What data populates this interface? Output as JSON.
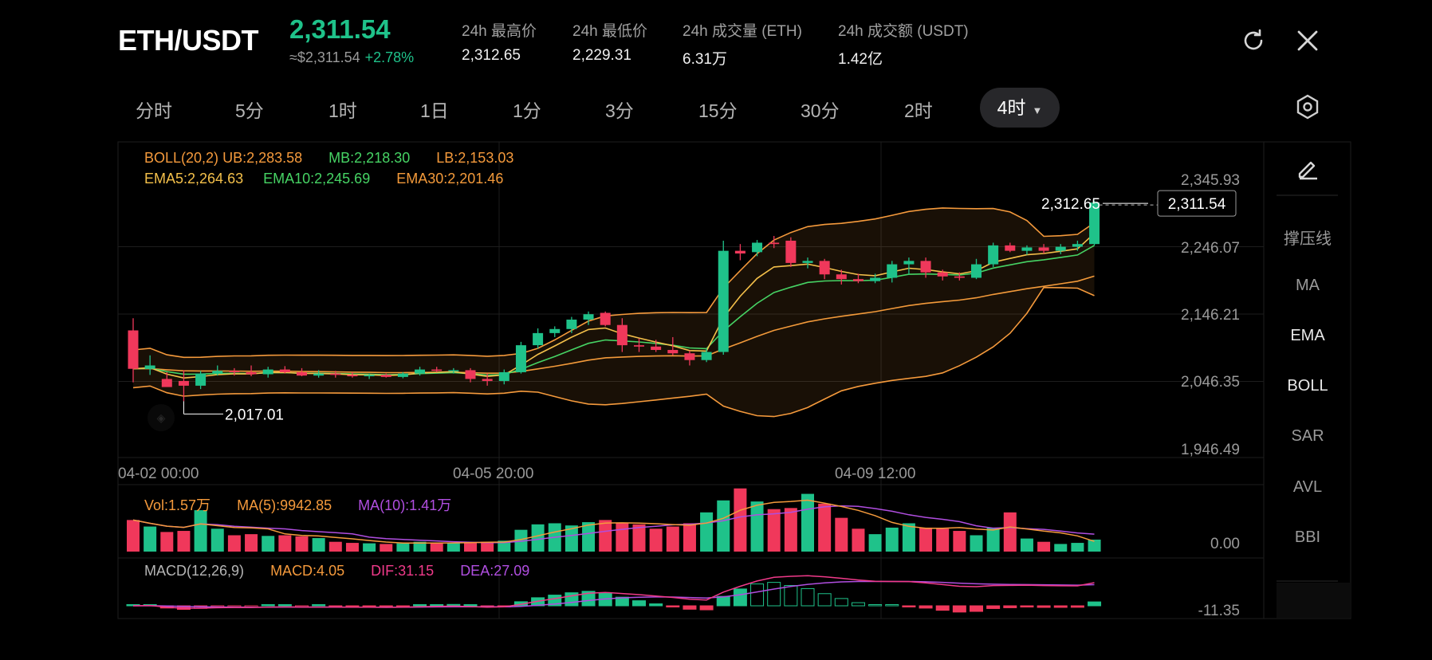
{
  "header": {
    "pair": "ETH/USDT",
    "price": "2,311.54",
    "approx_price": "≈$2,311.54",
    "change": "+2.78%",
    "stats": [
      {
        "label": "24h 最高价",
        "value": "2,312.65"
      },
      {
        "label": "24h 最低价",
        "value": "2,229.31"
      },
      {
        "label": "24h 成交量 (ETH)",
        "value": "6.31万"
      },
      {
        "label": "24h 成交额 (USDT)",
        "value": "1.42亿"
      }
    ],
    "refresh_icon": "refresh-icon",
    "close_icon": "close-icon"
  },
  "timeframes": [
    "分时",
    "5分",
    "1时",
    "1日",
    "1分",
    "3分",
    "15分",
    "30分",
    "2时"
  ],
  "active_timeframe": "4时",
  "settings_icon": "hexagon-gear-icon",
  "indicators": {
    "boll": {
      "name": "BOLL(20,2)",
      "ub": "UB:2,283.58",
      "mb": "MB:2,218.30",
      "lb": "LB:2,153.03"
    },
    "ema": {
      "ema5": "EMA5:2,264.63",
      "ema10": "EMA10:2,245.69",
      "ema30": "EMA30:2,201.46"
    },
    "vol": {
      "vol": "Vol:1.57万",
      "ma5": "MA(5):9942.85",
      "ma10": "MA(10):1.41万"
    },
    "macd": {
      "name": "MACD(12,26,9)",
      "macd": "MACD:4.05",
      "dif": "DIF:31.15",
      "dea": "DEA:27.09"
    }
  },
  "side_panel": {
    "draw_icon": "pencil-icon",
    "items": [
      "撑压线",
      "MA",
      "EMA",
      "BOLL",
      "SAR",
      "AVL",
      "BBI"
    ],
    "active": [
      "EMA",
      "BOLL"
    ]
  },
  "colors": {
    "up": "#1fc28a",
    "down": "#f0385b",
    "boll": "#f59a3c",
    "ema5": "#f4c04a",
    "ema10": "#46d364",
    "ema30": "#f39a3a",
    "ma10": "#b04ee0",
    "dif": "#f03a8a",
    "dea": "#b04ee0"
  },
  "chart_data": {
    "type": "candlestick",
    "price_axis_ticks": [
      "2,345.93",
      "2,246.07",
      "2,146.21",
      "2,046.35",
      "1,946.49"
    ],
    "time_axis_ticks": [
      "04-02 00:00",
      "04-05 20:00",
      "04-09 12:00"
    ],
    "high_label": "2,312.65",
    "low_label": "2,017.01",
    "last_price_label": "2,311.54",
    "volume_axis_label": "0.00",
    "macd_axis_label": "-11.35",
    "ylim": [
      1946.49,
      2345.93
    ],
    "candles": [
      [
        2122,
        2140,
        2045,
        2065
      ],
      [
        2065,
        2085,
        2056,
        2070
      ],
      [
        2050,
        2060,
        2045,
        2038
      ],
      [
        2047,
        2063,
        2017,
        2040
      ],
      [
        2040,
        2062,
        2035,
        2058
      ],
      [
        2058,
        2070,
        2055,
        2062
      ],
      [
        2062,
        2066,
        2055,
        2060
      ],
      [
        2060,
        2070,
        2054,
        2057
      ],
      [
        2057,
        2068,
        2052,
        2064
      ],
      [
        2064,
        2069,
        2058,
        2060
      ],
      [
        2060,
        2066,
        2054,
        2055
      ],
      [
        2055,
        2063,
        2052,
        2058
      ],
      [
        2058,
        2062,
        2052,
        2056
      ],
      [
        2056,
        2060,
        2052,
        2054
      ],
      [
        2054,
        2058,
        2050,
        2056
      ],
      [
        2056,
        2058,
        2052,
        2053
      ],
      [
        2053,
        2060,
        2051,
        2058
      ],
      [
        2058,
        2068,
        2055,
        2064
      ],
      [
        2064,
        2068,
        2060,
        2062
      ],
      [
        2062,
        2066,
        2058,
        2063
      ],
      [
        2063,
        2066,
        2045,
        2050
      ],
      [
        2050,
        2058,
        2040,
        2047
      ],
      [
        2047,
        2064,
        2042,
        2060
      ],
      [
        2060,
        2105,
        2058,
        2100
      ],
      [
        2100,
        2125,
        2095,
        2118
      ],
      [
        2118,
        2128,
        2112,
        2124
      ],
      [
        2124,
        2142,
        2118,
        2138
      ],
      [
        2138,
        2150,
        2130,
        2146
      ],
      [
        2148,
        2150,
        2128,
        2130
      ],
      [
        2130,
        2140,
        2090,
        2100
      ],
      [
        2100,
        2110,
        2090,
        2098
      ],
      [
        2098,
        2108,
        2090,
        2093
      ],
      [
        2093,
        2112,
        2085,
        2088
      ],
      [
        2088,
        2092,
        2070,
        2078
      ],
      [
        2078,
        2095,
        2075,
        2090
      ],
      [
        2090,
        2255,
        2086,
        2240
      ],
      [
        2240,
        2250,
        2226,
        2236
      ],
      [
        2238,
        2256,
        2232,
        2252
      ],
      [
        2252,
        2262,
        2244,
        2250
      ],
      [
        2255,
        2260,
        2216,
        2222
      ],
      [
        2222,
        2230,
        2214,
        2225
      ],
      [
        2225,
        2228,
        2198,
        2205
      ],
      [
        2205,
        2212,
        2190,
        2198
      ],
      [
        2198,
        2206,
        2192,
        2195
      ],
      [
        2195,
        2206,
        2192,
        2200
      ],
      [
        2200,
        2225,
        2193,
        2220
      ],
      [
        2220,
        2230,
        2205,
        2225
      ],
      [
        2225,
        2230,
        2200,
        2208
      ],
      [
        2208,
        2212,
        2196,
        2202
      ],
      [
        2202,
        2208,
        2196,
        2200
      ],
      [
        2200,
        2228,
        2198,
        2220
      ],
      [
        2220,
        2252,
        2216,
        2248
      ],
      [
        2248,
        2252,
        2238,
        2240
      ],
      [
        2240,
        2248,
        2234,
        2245
      ],
      [
        2245,
        2250,
        2236,
        2240
      ],
      [
        2240,
        2250,
        2235,
        2246
      ],
      [
        2246,
        2255,
        2240,
        2250
      ],
      [
        2250,
        2314,
        2248,
        2311.54
      ]
    ],
    "volumes": [
      1.45,
      1.15,
      0.9,
      0.95,
      1.9,
      1.05,
      0.75,
      0.8,
      0.72,
      0.75,
      0.7,
      0.62,
      0.45,
      0.4,
      0.38,
      0.35,
      0.38,
      0.45,
      0.42,
      0.4,
      0.42,
      0.45,
      0.5,
      1.0,
      1.25,
      1.3,
      1.2,
      1.35,
      1.45,
      1.3,
      1.25,
      1.05,
      1.15,
      1.3,
      1.8,
      2.35,
      2.9,
      2.3,
      1.95,
      2.0,
      2.65,
      2.2,
      1.55,
      1.05,
      0.8,
      1.1,
      1.3,
      1.1,
      1.05,
      0.95,
      0.75,
      1.1,
      1.8,
      0.6,
      0.45,
      0.35,
      0.4,
      0.55
    ]
  }
}
